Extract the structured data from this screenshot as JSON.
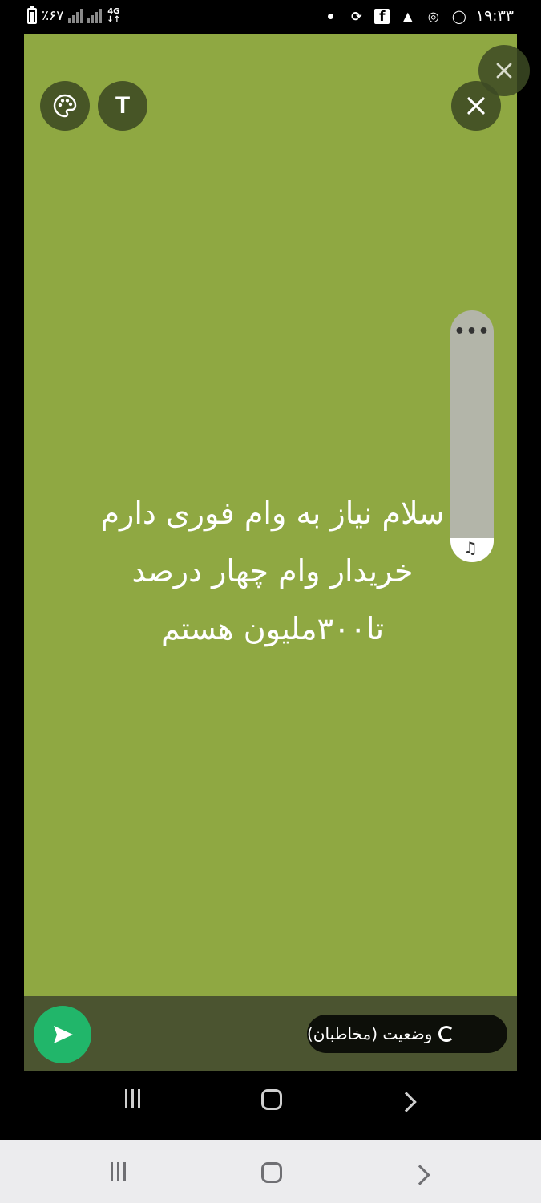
{
  "status_bar": {
    "battery_text": "٪۶۷",
    "network_type": "4G",
    "time": "۱۹:۳۳",
    "icons": [
      "dot-icon",
      "sync-icon",
      "facebook-icon",
      "warning-icon",
      "whatsapp-business-icon",
      "whatsapp-icon"
    ]
  },
  "composer": {
    "background_color": "#8fa842",
    "tools": {
      "palette_icon": "palette-icon",
      "text_label": "T",
      "close_icon": "close-icon"
    },
    "status_text_lines": [
      "سلام نیاز به وام فوری دارم",
      "خریدار وام چهار درصد",
      "تا۳۰۰ملیون هستم"
    ],
    "side_panel": {
      "more_icon": "•••",
      "music_icon": "♫"
    }
  },
  "action_bar": {
    "audience_label": "وضعیت (مخاطبان)",
    "send_icon": "send-icon"
  },
  "nav": {
    "recent_icon": "recent-apps-icon",
    "home_icon": "home-icon",
    "back_icon": "back-icon"
  }
}
